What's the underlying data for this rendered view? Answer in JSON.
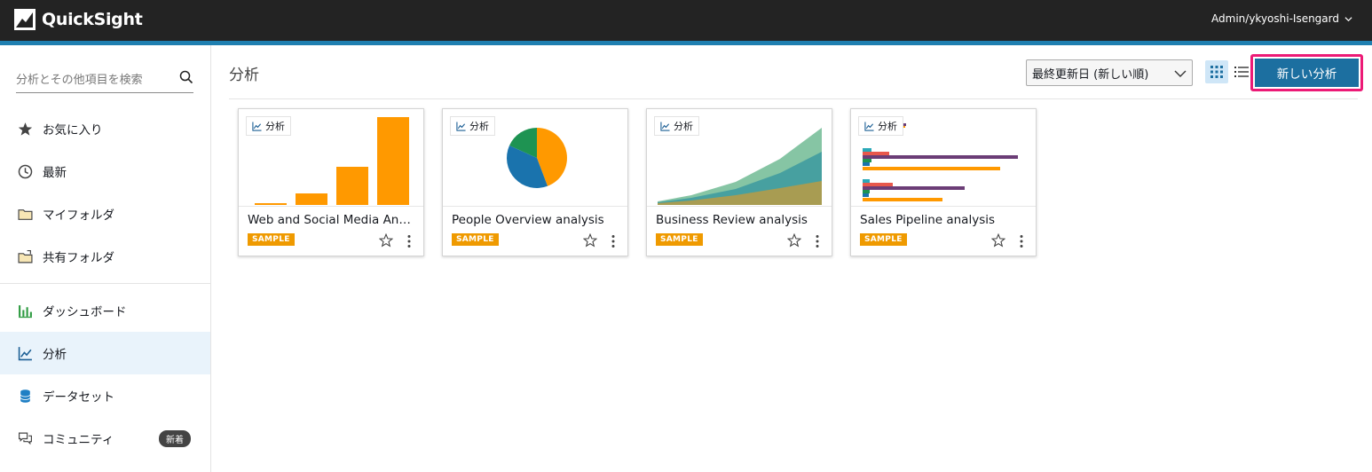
{
  "app": {
    "name": "QuickSight",
    "user": "Admin/ykyoshi-Isengard"
  },
  "sidebar": {
    "search_placeholder": "分析とその他項目を検索",
    "items": [
      {
        "label": "お気に入り",
        "icon": "star-icon"
      },
      {
        "label": "最新",
        "icon": "clock-icon"
      },
      {
        "label": "マイフォルダ",
        "icon": "folder-icon"
      },
      {
        "label": "共有フォルダ",
        "icon": "shared-folder-icon"
      },
      {
        "label": "ダッシュボード",
        "icon": "dashboard-icon"
      },
      {
        "label": "分析",
        "icon": "analysis-icon",
        "active": true
      },
      {
        "label": "データセット",
        "icon": "dataset-icon"
      },
      {
        "label": "コミュニティ",
        "icon": "community-icon",
        "badge": "新着"
      }
    ]
  },
  "main": {
    "title": "分析",
    "sort_label": "最終更新日 (新しい順)",
    "new_button": "新しい分析",
    "colors": {
      "accent": "#1c6fa0",
      "highlight": "#ec1a76",
      "sample": "#ef9a00"
    }
  },
  "cards": [
    {
      "type_label": "分析",
      "title": "Web and Social Media Anal...",
      "badge": "SAMPLE",
      "thumbnail": "bar-chart"
    },
    {
      "type_label": "分析",
      "title": "People Overview analysis",
      "badge": "SAMPLE",
      "thumbnail": "pie-chart"
    },
    {
      "type_label": "分析",
      "title": "Business Review analysis",
      "badge": "SAMPLE",
      "thumbnail": "area-chart"
    },
    {
      "type_label": "分析",
      "title": "Sales Pipeline analysis",
      "badge": "SAMPLE",
      "thumbnail": "horizontal-bar-chart"
    }
  ]
}
